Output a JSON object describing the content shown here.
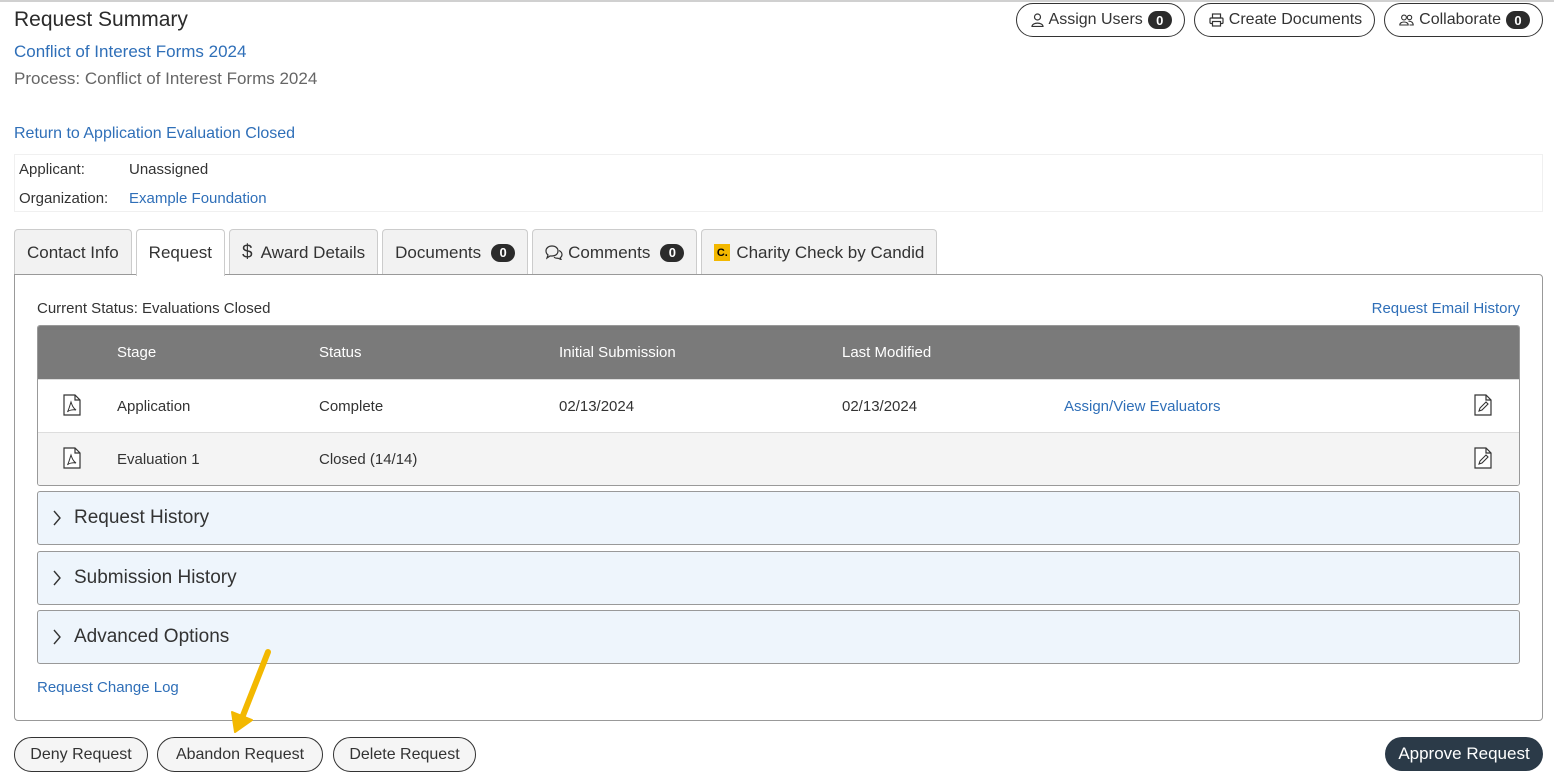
{
  "header": {
    "page_title": "Request Summary",
    "process_link": "Conflict of Interest Forms 2024",
    "process_label": "Process: Conflict of Interest Forms 2024",
    "return_link": "Return to Application Evaluation Closed",
    "buttons": [
      {
        "label": "Assign Users",
        "count": "0",
        "icon": "user-icon"
      },
      {
        "label": "Create Documents",
        "icon": "printer-icon"
      },
      {
        "label": "Collaborate",
        "count": "0",
        "icon": "users-icon"
      }
    ]
  },
  "info": {
    "applicant_label": "Applicant:",
    "applicant_value": "Unassigned",
    "organization_label": "Organization:",
    "organization_value": "Example Foundation"
  },
  "tabs": [
    {
      "label": "Contact Info"
    },
    {
      "label": "Request",
      "active": true
    },
    {
      "label": "Award Details",
      "icon": "dollar-icon"
    },
    {
      "label": "Documents",
      "count": "0"
    },
    {
      "label": "Comments",
      "count": "0",
      "icon": "comments-icon"
    },
    {
      "label": "Charity Check by Candid",
      "icon": "candid-logo-icon",
      "icon_text": "C."
    }
  ],
  "panel": {
    "current_status": "Current Status: Evaluations Closed",
    "email_history_link": "Request Email History",
    "table": {
      "headers": [
        "Stage",
        "Status",
        "Initial Submission",
        "Last Modified"
      ],
      "rows": [
        {
          "stage": "Application",
          "status": "Complete",
          "initial": "02/13/2024",
          "modified": "02/13/2024",
          "action": "Assign/View Evaluators"
        },
        {
          "stage": "Evaluation 1",
          "status": "Closed (14/14)",
          "initial": "",
          "modified": "",
          "action": ""
        }
      ]
    },
    "accordions": [
      "Request History",
      "Submission History",
      "Advanced Options"
    ],
    "change_log_link": "Request Change Log"
  },
  "footer": {
    "deny": "Deny Request",
    "abandon": "Abandon Request",
    "delete": "Delete Request",
    "approve": "Approve Request"
  },
  "colors": {
    "link": "#2f6fb8",
    "table_header": "#7a7a7a",
    "accordion_bg": "#eef5fc",
    "approve_bg": "#2b3a48",
    "annotation_arrow": "#f3b800"
  }
}
